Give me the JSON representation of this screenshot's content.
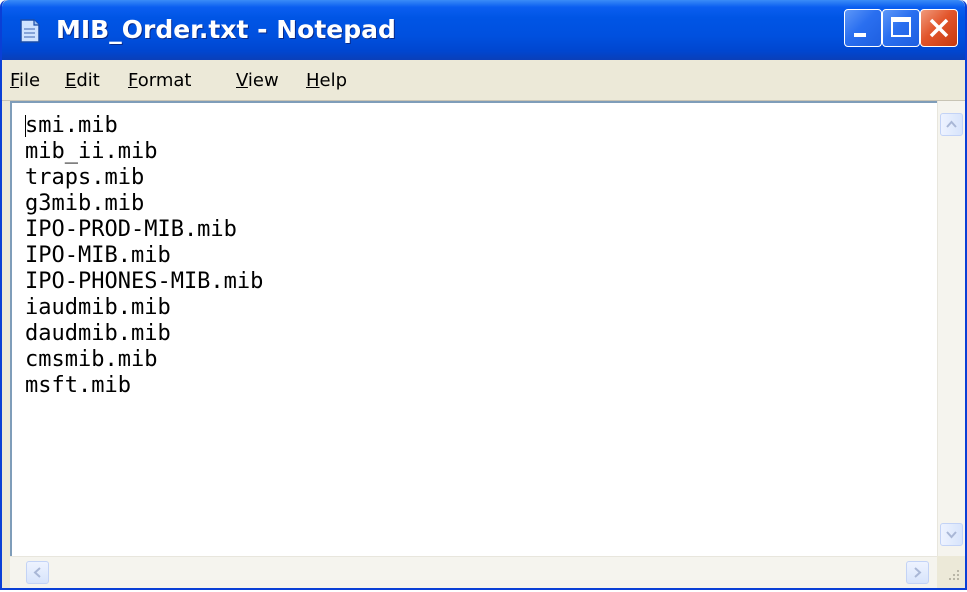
{
  "window": {
    "title": "MIB_Order.txt - Notepad"
  },
  "menu": {
    "file": "File",
    "edit": "Edit",
    "format": "Format",
    "view": "View",
    "help": "Help"
  },
  "editor": {
    "lines": [
      "smi.mib",
      "mib_ii.mib",
      "traps.mib",
      "g3mib.mib",
      "IPO-PROD-MIB.mib",
      "IPO-MIB.mib",
      "IPO-PHONES-MIB.mib",
      "iaudmib.mib",
      "daudmib.mib",
      "cmsmib.mib",
      "msft.mib"
    ]
  },
  "colors": {
    "titlebar": "#0055e5",
    "close_button": "#e2552b",
    "window_frame": "#ece9d8"
  },
  "icons": {
    "app": "notepad-icon",
    "minimize": "minimize-icon",
    "maximize": "maximize-icon",
    "close": "close-icon"
  }
}
